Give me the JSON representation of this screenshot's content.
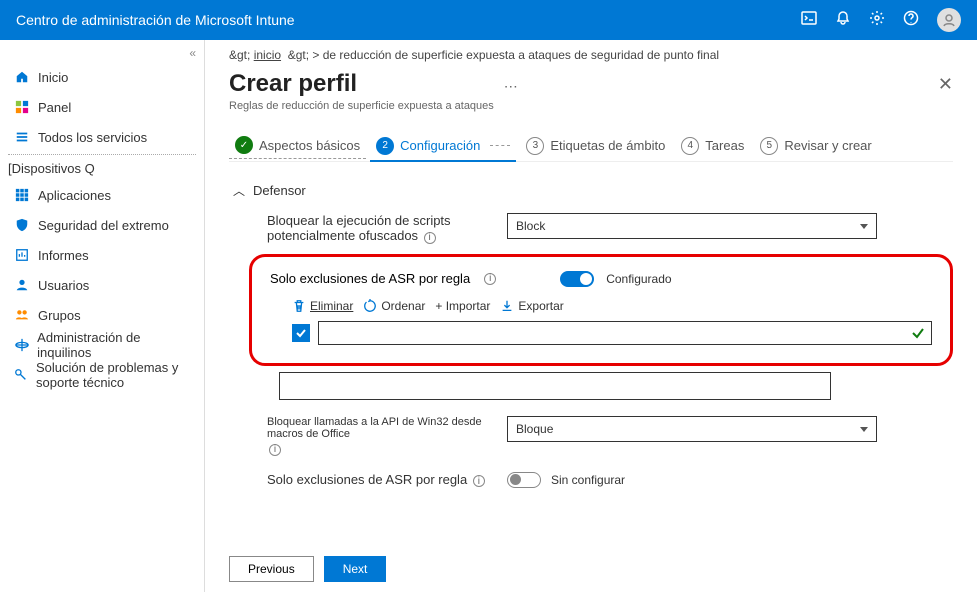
{
  "header": {
    "title": "Centro de administración de Microsoft Intune"
  },
  "nav": {
    "items": [
      {
        "label": "Inicio"
      },
      {
        "label": "Panel"
      },
      {
        "label": "Todos los servicios"
      }
    ],
    "section": "[Dispositivos Q",
    "items2": [
      {
        "label": "Aplicaciones"
      },
      {
        "label": "Seguridad del extremo"
      },
      {
        "label": "Informes"
      },
      {
        "label": "Usuarios"
      },
      {
        "label": "Grupos"
      },
      {
        "label": "Administración de inquilinos"
      },
      {
        "label": "Solución de problemas y soporte técnico"
      }
    ]
  },
  "crumb": {
    "a": ">",
    "b": "inicio",
    "c": "> de reducción de superficie expuesta a ataques de seguridad de punto final"
  },
  "page": {
    "title": "Crear perfil",
    "subtitle": "Reglas de reducción de superficie expuesta a ataques"
  },
  "wizard": {
    "s1": "Aspectos básicos",
    "s2": "Configuración",
    "s3": "Etiquetas de ámbito",
    "s4": "Tareas",
    "s5": "Revisar y crear",
    "n2": "2",
    "n3": "3",
    "n4": "4",
    "n5": "5"
  },
  "section": {
    "title": "Defensor"
  },
  "field1": {
    "label": "Bloquear la ejecución de scripts potencialmente ofuscados",
    "value": "Block"
  },
  "hl": {
    "label": "Solo exclusiones de ASR por regla",
    "toggle": "Configurado",
    "tb_delete": "Eliminar",
    "tb_sort": "Ordenar",
    "tb_import": "+ Importar",
    "tb_export": "Exportar"
  },
  "field2": {
    "label": "Bloquear llamadas a la API de Win32 desde macros de Office",
    "value": "Bloque"
  },
  "toggle2": {
    "label": "Solo exclusiones de ASR por regla",
    "state": "Sin configurar"
  },
  "buttons": {
    "prev": "Previous",
    "next": "Next"
  }
}
